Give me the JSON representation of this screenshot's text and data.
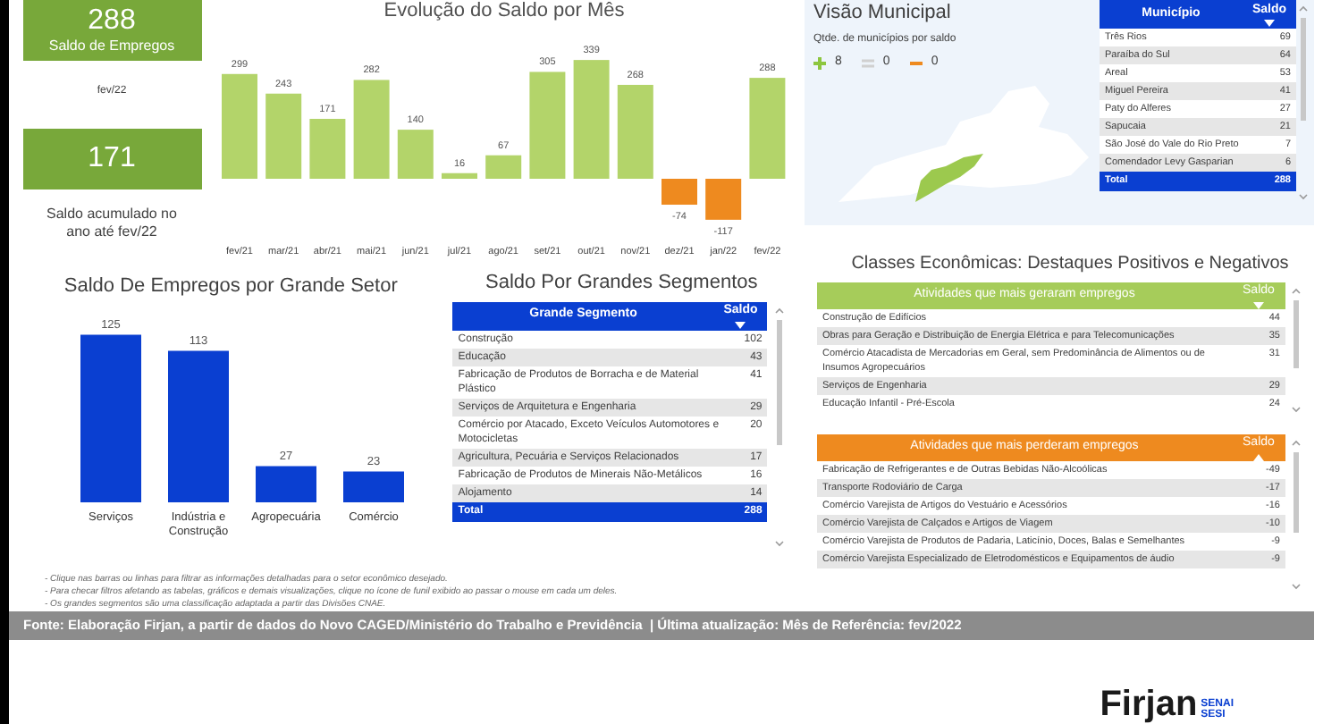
{
  "kpi_month": {
    "value": "288",
    "label": "Saldo de Empregos",
    "caption": "fev/22"
  },
  "kpi_year": {
    "value": "171",
    "caption": "Saldo acumulado no ano até fev/22"
  },
  "monthly_chart": {
    "chart_data": {
      "type": "bar",
      "title": "Evolução do Saldo por Mês",
      "categories": [
        "fev/21",
        "mar/21",
        "abr/21",
        "mai/21",
        "jun/21",
        "jul/21",
        "ago/21",
        "set/21",
        "out/21",
        "nov/21",
        "dez/21",
        "jan/22",
        "fev/22"
      ],
      "values": [
        299,
        243,
        171,
        282,
        140,
        16,
        67,
        305,
        339,
        268,
        -74,
        -117,
        288
      ],
      "data_labels": true
    }
  },
  "municipal": {
    "title": "Visão Municipal",
    "subtitle": "Qtde. de municípios por saldo",
    "legend": [
      {
        "kind": "positive",
        "count": "8"
      },
      {
        "kind": "neutral",
        "count": "0"
      },
      {
        "kind": "negative",
        "count": "0"
      }
    ],
    "table": {
      "columns": [
        "Município",
        "Saldo"
      ],
      "rows": [
        [
          "Três Rios",
          "69"
        ],
        [
          "Paraíba do Sul",
          "64"
        ],
        [
          "Areal",
          "53"
        ],
        [
          "Miguel Pereira",
          "41"
        ],
        [
          "Paty do Alferes",
          "27"
        ],
        [
          "Sapucaia",
          "21"
        ],
        [
          "São José do Vale do Rio Preto",
          "7"
        ],
        [
          "Comendador Levy Gasparian",
          "6"
        ]
      ],
      "total": [
        "Total",
        "288"
      ]
    }
  },
  "sector_chart": {
    "chart_data": {
      "type": "bar",
      "title": "Saldo De Empregos por Grande Setor",
      "categories": [
        "Serviços",
        "Indústria e Construção",
        "Agropecuária",
        "Comércio"
      ],
      "values": [
        125,
        113,
        27,
        23
      ],
      "data_labels": true
    }
  },
  "segments": {
    "title": "Saldo Por Grandes Segmentos",
    "columns": [
      "Grande Segmento",
      "Saldo"
    ],
    "rows": [
      [
        "Construção",
        "102"
      ],
      [
        "Educação",
        "43"
      ],
      [
        "Fabricação de Produtos de Borracha e de Material Plástico",
        "41"
      ],
      [
        "Serviços de Arquitetura e Engenharia",
        "29"
      ],
      [
        "Comércio por Atacado, Exceto Veículos Automotores e Motocicletas",
        "20"
      ],
      [
        "Agricultura, Pecuária e Serviços Relacionados",
        "17"
      ],
      [
        "Fabricação de Produtos de Minerais Não-Metálicos",
        "16"
      ],
      [
        "Alojamento",
        "14"
      ]
    ],
    "total": [
      "Total",
      "288"
    ]
  },
  "classes": {
    "title": "Classes Econômicas: Destaques Positivos e Negativos",
    "tables": [
      {
        "kind": "positive",
        "columns": [
          "Atividades que mais geraram empregos",
          "Saldo"
        ],
        "rows": [
          [
            "Construção de Edifícios",
            "44"
          ],
          [
            "Obras para Geração e Distribuição de Energia Elétrica e para Telecomunicações",
            "35"
          ],
          [
            "Comércio Atacadista de Mercadorias em Geral, sem Predominância de Alimentos ou de Insumos Agropecuários",
            "31"
          ],
          [
            "Serviços de Engenharia",
            "29"
          ],
          [
            "Educação Infantil - Pré-Escola",
            "24"
          ]
        ]
      },
      {
        "kind": "negative",
        "columns": [
          "Atividades que mais perderam empregos",
          "Saldo"
        ],
        "rows": [
          [
            "Fabricação de Refrigerantes e de Outras Bebidas Não-Alcoólicas",
            "-49"
          ],
          [
            "Transporte Rodoviário de Carga",
            "-17"
          ],
          [
            "Comércio Varejista de Artigos do Vestuário e Acessórios",
            "-16"
          ],
          [
            "Comércio Varejista de Calçados e Artigos de Viagem",
            "-10"
          ],
          [
            "Comércio Varejista de Produtos de Padaria, Laticínio, Doces, Balas e Semelhantes",
            "-9"
          ],
          [
            "Comércio Varejista Especializado de Eletrodomésticos e Equipamentos de áudio",
            "-9"
          ]
        ]
      }
    ]
  },
  "notes": [
    "- Clique nas barras ou linhas para filtrar as informações detalhadas para o setor econômico desejado.",
    "- Para checar filtros afetando as tabelas, gráficos e demais visualizações, clique no ícone de funil exibido ao passar o mouse em cada um deles.",
    "- Os grandes segmentos são uma classificação adaptada a partir das Divisões CNAE."
  ],
  "footer": "Fonte: Elaboração Firjan, a partir de dados do Novo CAGED/Ministério do Trabalho e Previdência  | Última atualização: Mês de Referência: fev/2022",
  "logo": {
    "name": "Firjan",
    "sub": [
      "SENAI",
      "SESI"
    ]
  }
}
